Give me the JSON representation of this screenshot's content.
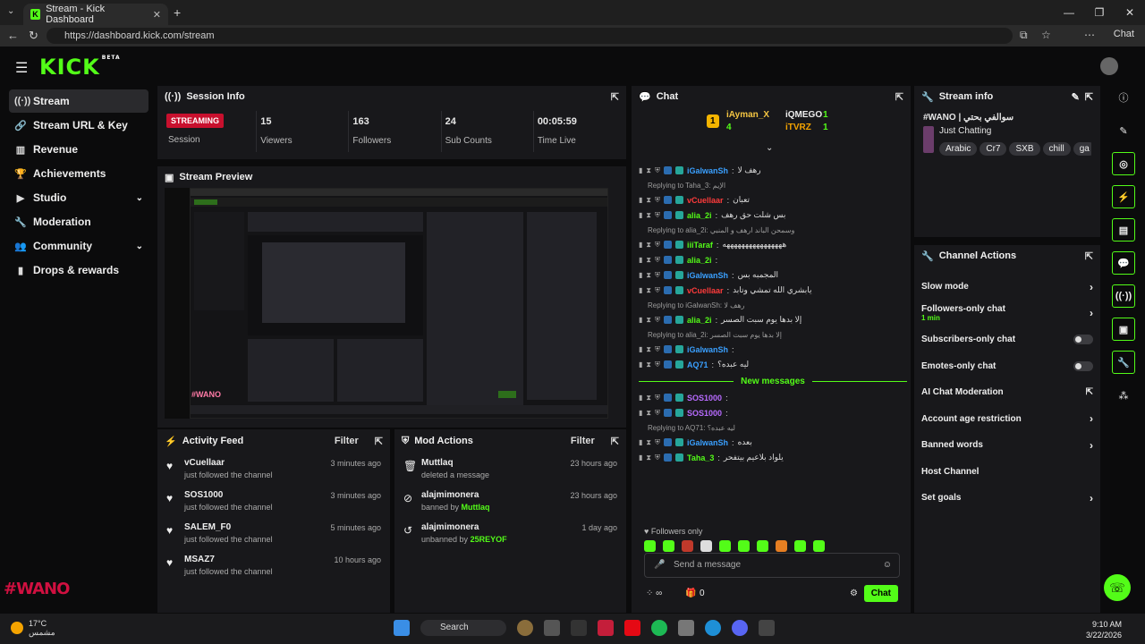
{
  "browser": {
    "tab_title": "Stream - Kick Dashboard",
    "url": "https://dashboard.kick.com/stream",
    "chat_button": "Chat"
  },
  "app": {
    "logo": "KICK",
    "logo_beta": "BETA"
  },
  "sidebar": {
    "items": [
      {
        "label": "Stream",
        "icon": "broadcast-icon"
      },
      {
        "label": "Stream URL & Key",
        "icon": "link-icon"
      },
      {
        "label": "Revenue",
        "icon": "money-icon"
      },
      {
        "label": "Achievements",
        "icon": "trophy-icon"
      },
      {
        "label": "Studio",
        "icon": "video-icon"
      },
      {
        "label": "Moderation",
        "icon": "wrench-icon"
      },
      {
        "label": "Community",
        "icon": "users-icon"
      },
      {
        "label": "Drops & rewards",
        "icon": "bars-icon"
      }
    ]
  },
  "session": {
    "title": "Session Info",
    "status": "STREAMING",
    "status_label": "Session",
    "stats": [
      {
        "value": "15",
        "label": "Viewers"
      },
      {
        "value": "163",
        "label": "Followers"
      },
      {
        "value": "24",
        "label": "Sub Counts"
      },
      {
        "value": "00:05:59",
        "label": "Time Live"
      }
    ]
  },
  "preview": {
    "title": "Stream Preview",
    "overlay_text": "#WANO"
  },
  "activity": {
    "title": "Activity Feed",
    "filter": "Filter",
    "items": [
      {
        "name": "vCuellaar",
        "action": "just followed the channel",
        "time": "3 minutes ago"
      },
      {
        "name": "SOS1000",
        "action": "just followed the channel",
        "time": "3 minutes ago"
      },
      {
        "name": "SALEM_F0",
        "action": "just followed the channel",
        "time": "5 minutes ago"
      },
      {
        "name": "MSAZ7",
        "action": "just followed the channel",
        "time": "10 hours ago"
      }
    ]
  },
  "mod": {
    "title": "Mod Actions",
    "filter": "Filter",
    "items": [
      {
        "name": "Muttlaq",
        "action": "deleted a message",
        "by": "",
        "time": "23 hours ago"
      },
      {
        "name": "alajmimonera",
        "action": "banned by ",
        "by": "Muttlaq",
        "time": "23 hours ago"
      },
      {
        "name": "alajmimonera",
        "action": "unbanned by ",
        "by": "25REYOF",
        "time": "1 day ago"
      }
    ]
  },
  "chat": {
    "title": "Chat",
    "leaders": [
      {
        "rank": "1",
        "name": "iAyman_X",
        "count": "4"
      },
      {
        "name": "iQMEGO",
        "count": "1"
      },
      {
        "name": "iTVRZ",
        "count": "1"
      }
    ],
    "messages": [
      {
        "type": "msg",
        "user": "iGalwanSh",
        "color": "#3aa0ff",
        "text": "رهف لا"
      },
      {
        "type": "reply",
        "text": "Replying to Taha_3: الإيم"
      },
      {
        "type": "msg",
        "user": "vCuellaar",
        "color": "#ff3b3b",
        "text": "تعبان"
      },
      {
        "type": "msg",
        "user": "alia_2i",
        "color": "#53fc18",
        "text": "بس شلت حق رهف"
      },
      {
        "type": "reply",
        "text": "Replying to alia_2i: وسمحن الباند ارهف و المنبي"
      },
      {
        "type": "msg",
        "user": "iiiTaraf",
        "color": "#53fc18",
        "text": "ههههههههههههههههه"
      },
      {
        "type": "msg",
        "user": "alia_2i",
        "color": "#53fc18",
        "text": ""
      },
      {
        "type": "msg",
        "user": "iGalwanSh",
        "color": "#3aa0ff",
        "text": "المجمبه بس"
      },
      {
        "type": "msg",
        "user": "vCuellaar",
        "color": "#ff3b3b",
        "text": "يابشري الله تمشي وتابد"
      },
      {
        "type": "reply",
        "text": "Replying to iGalwanSh: رهف لا"
      },
      {
        "type": "msg",
        "user": "alia_2i",
        "color": "#53fc18",
        "text": "إلا بدها يوم سبت الصسر"
      },
      {
        "type": "reply",
        "text": "Replying to alia_2i: إلا بدها يوم سبت الصسر"
      },
      {
        "type": "msg",
        "user": "iGalwanSh",
        "color": "#3aa0ff",
        "text": ""
      },
      {
        "type": "msg",
        "user": "AQ71",
        "color": "#3aa0ff",
        "text": "ليه عبده؟"
      }
    ],
    "new_messages": "New messages",
    "after": [
      {
        "type": "msg",
        "user": "SOS1000",
        "color": "#b86bff",
        "text": ""
      },
      {
        "type": "msg",
        "user": "SOS1000",
        "color": "#b86bff",
        "text": ""
      },
      {
        "type": "reply",
        "text": "Replying to AQ71: ليه عبده؟"
      },
      {
        "type": "msg",
        "user": "iGalwanSh",
        "color": "#3aa0ff",
        "text": "بعده"
      },
      {
        "type": "msg",
        "user": "Taha_3",
        "color": "#53fc18",
        "text": "يلواد بلاعيم بيتفحر"
      }
    ],
    "followers_only": "Followers only",
    "placeholder": "Send a message",
    "points": "0",
    "send_label": "Chat"
  },
  "stream_info": {
    "title": "Stream info",
    "stream_title": "#WANO | سوالفي بحتي",
    "category": "Just Chatting",
    "tags": [
      "Arabic",
      "Cr7",
      "SXB",
      "chill",
      "ga"
    ]
  },
  "channel_actions": {
    "title": "Channel Actions",
    "items": [
      {
        "label": "Slow mode",
        "sub": "",
        "kind": "chevron"
      },
      {
        "label": "Followers-only chat",
        "sub": "1 min",
        "kind": "chevron"
      },
      {
        "label": "Subscribers-only chat",
        "sub": "",
        "kind": "toggle"
      },
      {
        "label": "Emotes-only chat",
        "sub": "",
        "kind": "toggle"
      },
      {
        "label": "AI Chat Moderation",
        "sub": "",
        "kind": "external"
      },
      {
        "label": "Account age restriction",
        "sub": "",
        "kind": "chevron"
      },
      {
        "label": "Banned words",
        "sub": "",
        "kind": "chevron"
      },
      {
        "label": "Host Channel",
        "sub": "",
        "kind": "none"
      },
      {
        "label": "Set goals",
        "sub": "",
        "kind": "chevron"
      }
    ]
  },
  "taskbar": {
    "temp": "17°C",
    "weather": "مشمس",
    "search": "Search",
    "time": "9:10 AM",
    "date": "3/22/2026"
  },
  "colors": {
    "accent": "#53fc18",
    "live": "#c8102e",
    "panel": "#18181b"
  }
}
